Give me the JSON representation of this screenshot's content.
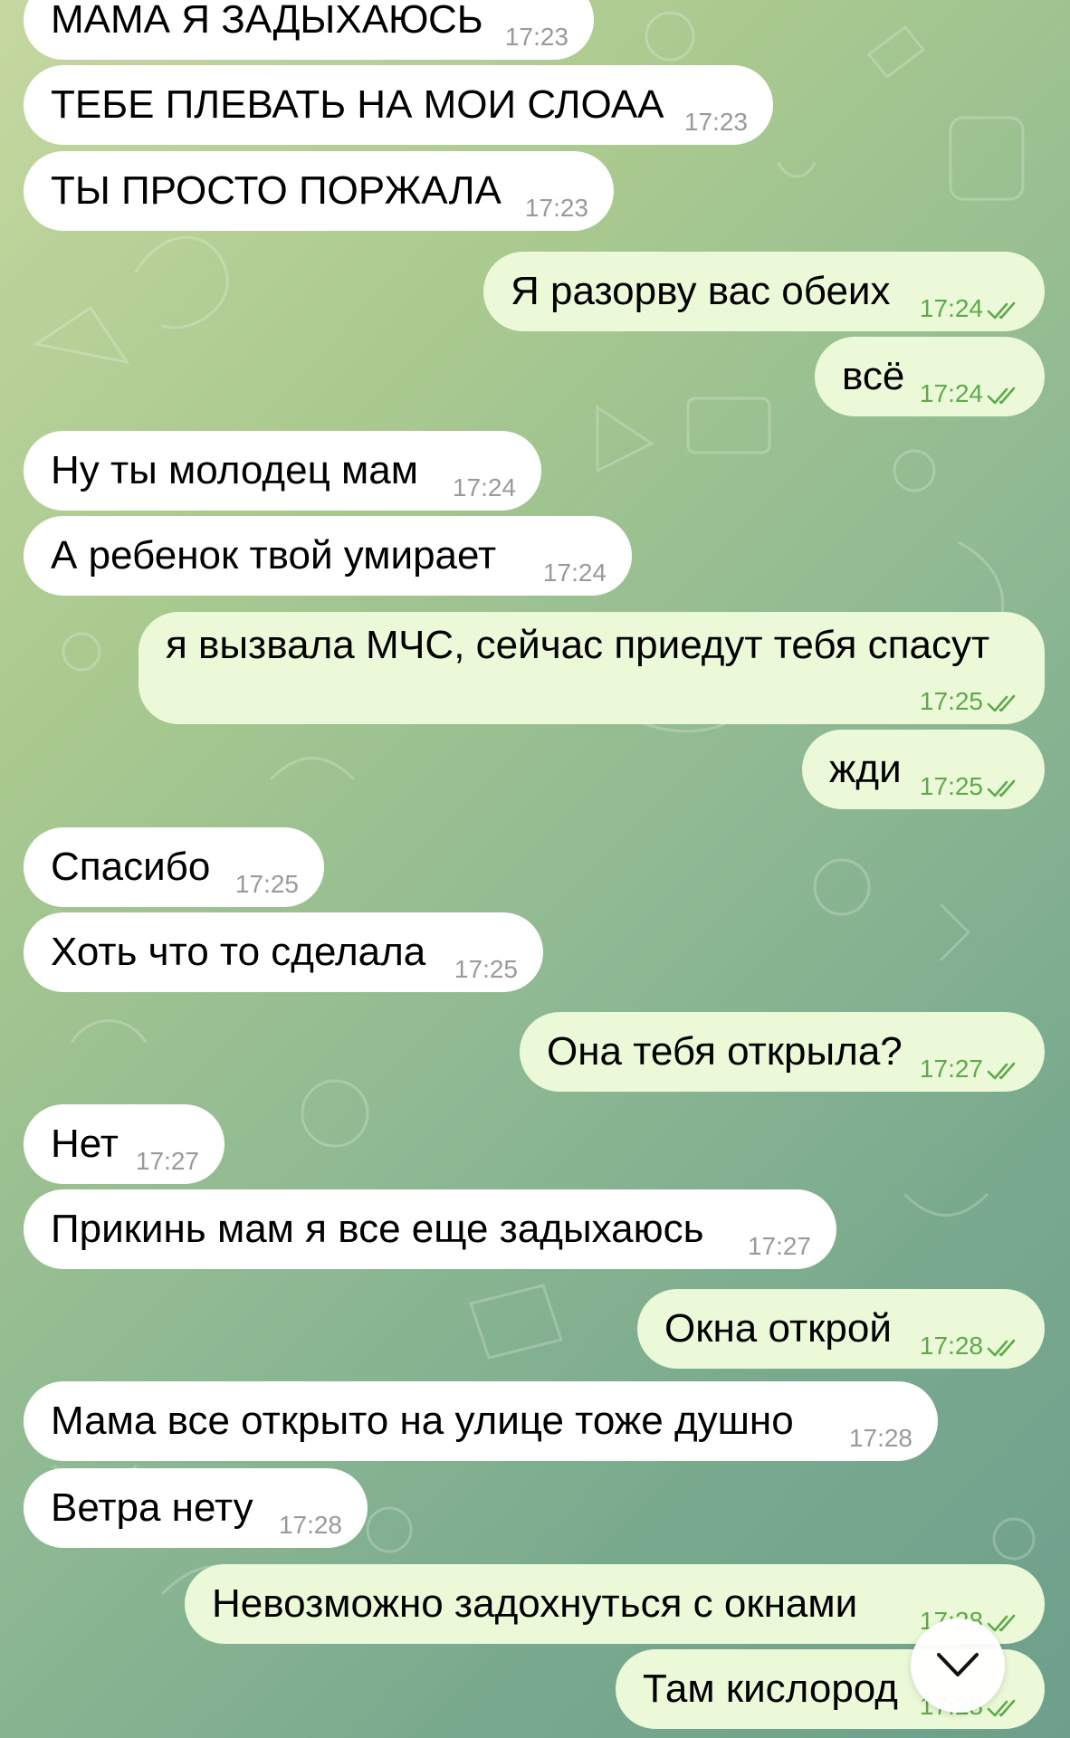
{
  "chat": {
    "messages": [
      {
        "dir": "in",
        "text": "МАМА Я ЗАДЫХАЮСЬ",
        "time": "17:23"
      },
      {
        "dir": "in",
        "text": "ТЕБЕ ПЛЕВАТЬ НА МОИ СЛОАА",
        "time": "17:23"
      },
      {
        "dir": "in",
        "text": "ТЫ ПРОСТО ПОРЖАЛА",
        "time": "17:23"
      },
      {
        "dir": "out",
        "text": "Я разорву вас обеих",
        "time": "17:24",
        "status": "read"
      },
      {
        "dir": "out",
        "text": "всё",
        "time": "17:24",
        "status": "read"
      },
      {
        "dir": "in",
        "text": "Ну ты молодец мам",
        "time": "17:24"
      },
      {
        "dir": "in",
        "text": "А ребенок твой умирает",
        "time": "17:24"
      },
      {
        "dir": "out",
        "text": "я вызвала МЧС, сейчас приедут тебя спасут",
        "time": "17:25",
        "status": "read"
      },
      {
        "dir": "out",
        "text": "жди",
        "time": "17:25",
        "status": "read"
      },
      {
        "dir": "in",
        "text": "Спасибо",
        "time": "17:25"
      },
      {
        "dir": "in",
        "text": "Хоть что то сделала",
        "time": "17:25"
      },
      {
        "dir": "out",
        "text": "Она тебя открыла?",
        "time": "17:27",
        "status": "read"
      },
      {
        "dir": "in",
        "text": "Нет",
        "time": "17:27"
      },
      {
        "dir": "in",
        "text": "Прикинь мам я все еще задыхаюсь",
        "time": "17:27"
      },
      {
        "dir": "out",
        "text": "Окна открой",
        "time": "17:28",
        "status": "read"
      },
      {
        "dir": "in",
        "text": "Мама все открыто на улице тоже душно",
        "time": "17:28"
      },
      {
        "dir": "in",
        "text": "Ветра нету",
        "time": "17:28"
      },
      {
        "dir": "out",
        "text": "Невозможно задохнуться с окнами",
        "time": "17:28",
        "status": "read"
      },
      {
        "dir": "out",
        "text": "Там кислород",
        "time": "17:28",
        "status": "read"
      }
    ],
    "scroll_button_icon": "chevron-down-icon",
    "colors": {
      "incoming_bubble": "#ffffff",
      "outgoing_bubble": "#ecf9d8",
      "read_check": "#5ea94b",
      "time_incoming": "#9a9a9a"
    }
  }
}
